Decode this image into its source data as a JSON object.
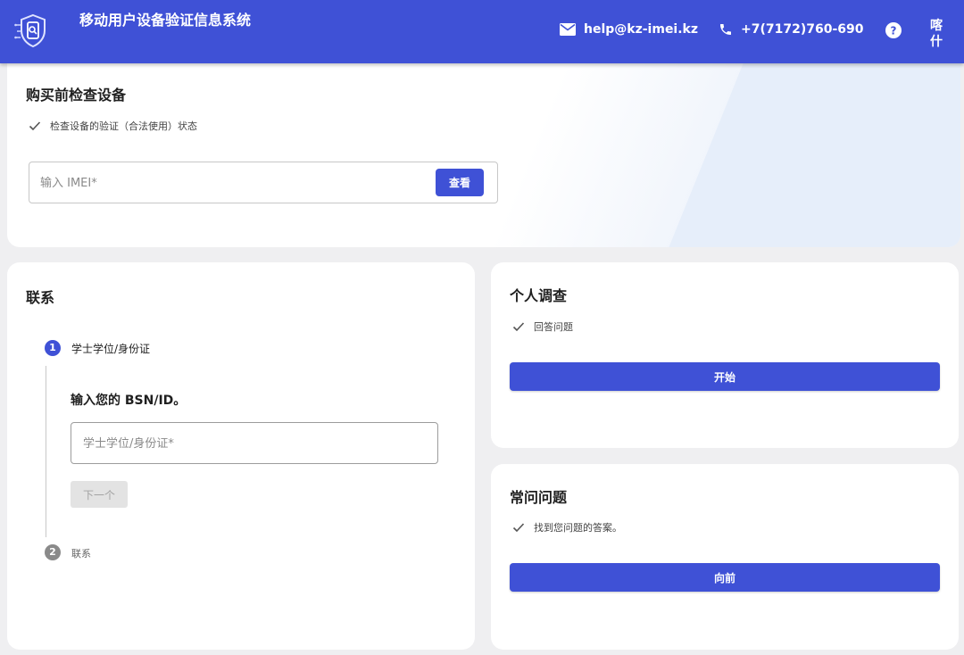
{
  "header": {
    "title": "移动用户设备验证信息系统",
    "email": "help@kz-imei.kz",
    "phone": "+7(7172)760-690",
    "language": "喀什"
  },
  "check_device": {
    "title": "购买前检查设备",
    "subtitle": "检查设备的验证（合法使用）状态",
    "imei_placeholder": "输入 IMEI*",
    "imei_value": "",
    "button": "查看"
  },
  "contact": {
    "title": "联系",
    "steps": [
      {
        "number": "1",
        "label": "学士学位/身份证"
      },
      {
        "number": "2",
        "label": "联系"
      }
    ],
    "heading": "输入您的 BSN/ID。",
    "input_placeholder": "学士学位/身份证*",
    "input_value": "",
    "next_button": "下一个"
  },
  "survey": {
    "title": "个人调查",
    "subtitle": "回答问题",
    "button": "开始"
  },
  "faq": {
    "title": "常问问题",
    "subtitle": "找到您问题的答案。",
    "button": "向前"
  },
  "colors": {
    "primary": "#3f51d6",
    "background": "#efeff1",
    "step_active": "#3f51d6",
    "step_inactive": "#8a8a8a"
  }
}
